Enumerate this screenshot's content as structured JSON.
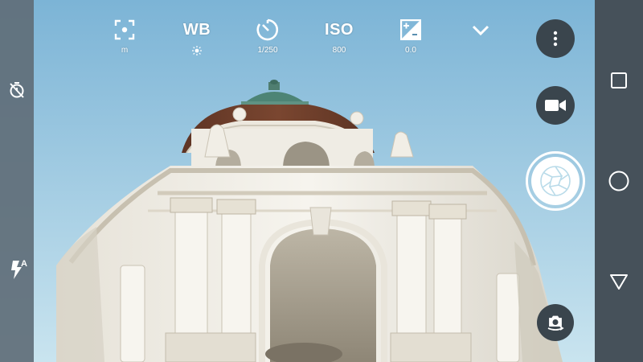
{
  "settings": {
    "focus": {
      "icon": "focus-frame-icon",
      "value": "m"
    },
    "white_balance": {
      "label": "WB",
      "value_icon": "auto-white-balance-icon"
    },
    "shutter": {
      "icon": "shutter-speed-timer-icon",
      "value": "1/250"
    },
    "iso": {
      "label": "ISO",
      "value": "800"
    },
    "exposure": {
      "icon": "exposure-compensation-icon",
      "value": "0.0"
    },
    "expand": {
      "icon": "chevron-down-icon"
    }
  },
  "left_rail": {
    "timer_icon": "timer-off-icon",
    "flash_icon": "flash-auto-icon",
    "flash_badge": "A"
  },
  "right_controls": {
    "menu_icon": "more-vertical-icon",
    "video_icon": "video-camera-icon",
    "shutter_icon": "aperture-icon",
    "switch_icon": "switch-camera-icon"
  },
  "nav": {
    "recents_icon": "recents-square-icon",
    "home_icon": "home-circle-icon",
    "back_icon": "back-triangle-icon"
  },
  "colors": {
    "sky_top": "#7fb7d8",
    "sky_bottom": "#c7e3ef",
    "building": "#f2f0ea",
    "dome": "#6e3e2a",
    "control_dark": "#37424a",
    "nav_bar": "#46515a",
    "left_rail": "#606e78"
  }
}
